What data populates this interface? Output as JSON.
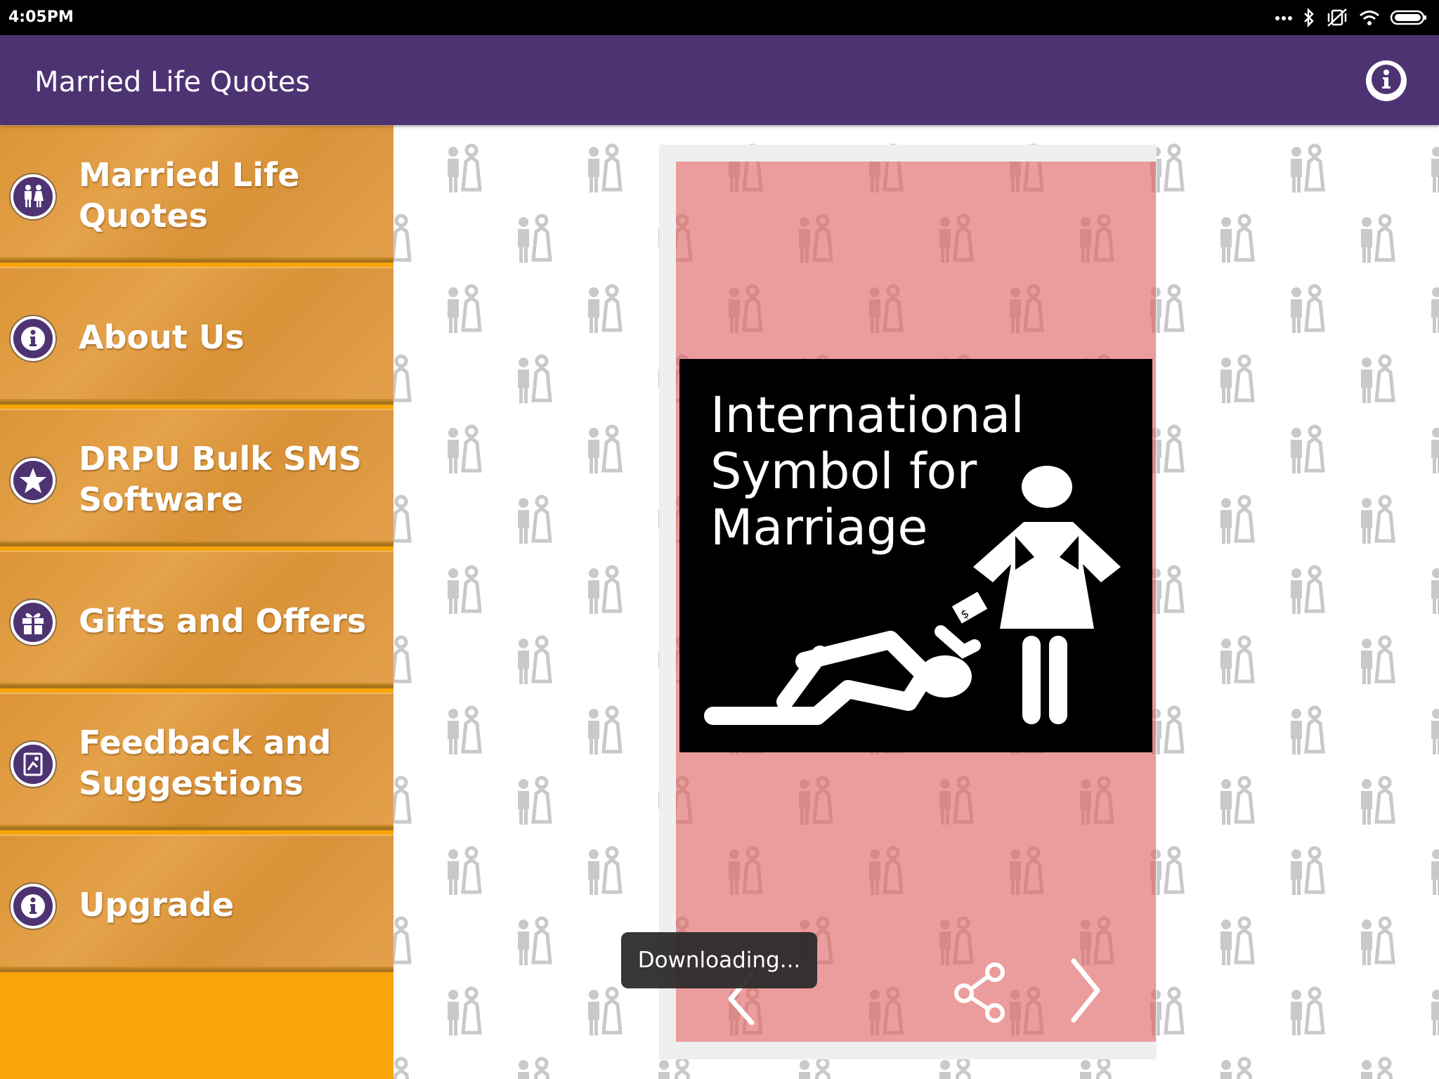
{
  "status_bar": {
    "time": "4:05PM",
    "icons": [
      "more-dots-icon",
      "bluetooth-icon",
      "vibrate-off-icon",
      "wifi-icon",
      "battery-icon"
    ]
  },
  "app_bar": {
    "title": "Married Life Quotes",
    "info_icon": "info-icon",
    "color": "#4e3373"
  },
  "drawer": {
    "accent": "#f9a408",
    "items": [
      {
        "label": "Married Life Quotes",
        "icon": "couple-icon"
      },
      {
        "label": "About Us",
        "icon": "info-icon"
      },
      {
        "label": "DRPU Bulk SMS Software",
        "icon": "star-icon"
      },
      {
        "label": "Gifts and Offers",
        "icon": "gift-icon"
      },
      {
        "label": "Feedback and Suggestions",
        "icon": "feedback-icon"
      },
      {
        "label": "Upgrade",
        "icon": "info-icon"
      }
    ]
  },
  "quote_card": {
    "text": "International Symbol for Marriage",
    "background": "#eb9a9a",
    "controls": [
      "chevron-left-icon",
      "share-icon",
      "chevron-right-icon"
    ]
  },
  "toast": {
    "text": "Downloading..."
  }
}
